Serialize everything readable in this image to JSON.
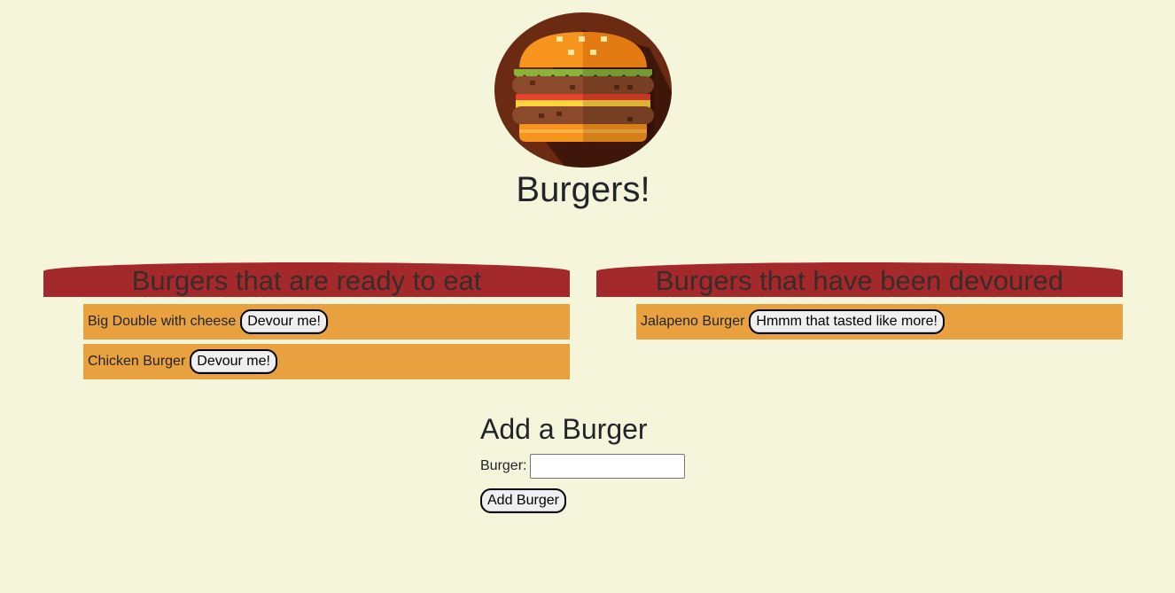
{
  "page": {
    "title": "Burgers!"
  },
  "logo": {
    "icon": "burger-logo-icon",
    "colors": {
      "circle": "#6b2b12",
      "shadow": "#3e160a",
      "bun": "#f7941d",
      "lettuce": "#8bb33a",
      "patty": "#8a4a2b",
      "tomato": "#e8412c",
      "cheese": "#ffd23f"
    }
  },
  "ready": {
    "header": "Burgers that are ready to eat",
    "items": [
      {
        "name": "Big Double with cheese",
        "button": "Devour me!"
      },
      {
        "name": "Chicken Burger",
        "button": "Devour me!"
      }
    ]
  },
  "devoured": {
    "header": "Burgers that have been devoured",
    "items": [
      {
        "name": "Jalapeno Burger",
        "button": "Hmmm that tasted like more!"
      }
    ]
  },
  "form": {
    "title": "Add a Burger",
    "label": "Burger:",
    "value": "",
    "placeholder": "",
    "submit": "Add Burger"
  },
  "colors": {
    "background": "#f5f5dc",
    "header": "#a3292b",
    "item": "#e9a140"
  }
}
